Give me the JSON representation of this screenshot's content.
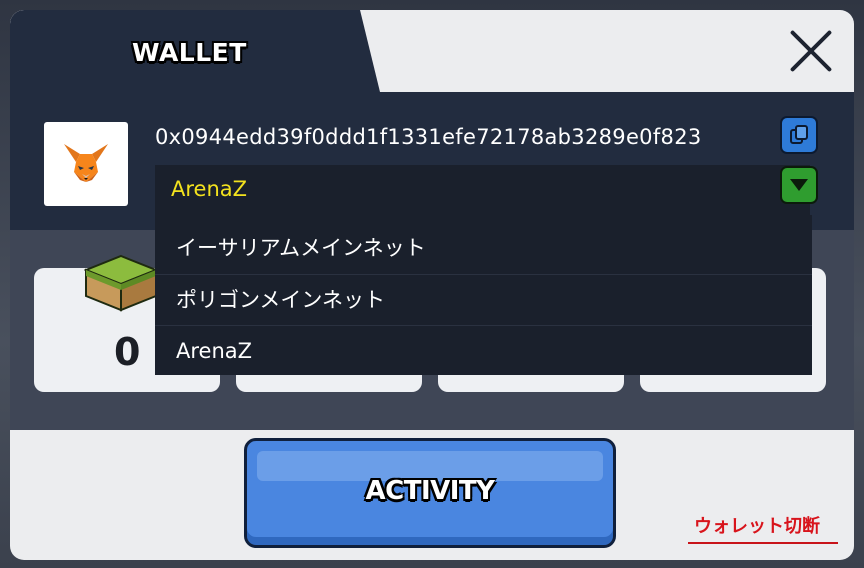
{
  "wallet_panel": {
    "tab_title": "WALLET",
    "address": "0x0944edd39f0ddd1f1331efe72178ab3289e0f823",
    "network_select": {
      "selected": "ArenaZ",
      "options": [
        "イーサリアムメインネット",
        "ポリゴンメインネット",
        "ArenaZ"
      ]
    },
    "stats": [
      {
        "icon": "land-cube-icon",
        "count": "0"
      }
    ],
    "activity_label": "ACTIVITY",
    "disconnect_label": "ウォレット切断"
  },
  "icons": {
    "avatar": "metamask-fox-icon",
    "copy": "copy-icon",
    "dropdown": "triangle-down-icon",
    "close": "close-icon"
  },
  "colors": {
    "panel_dark": "#222c3f",
    "select_text": "#f3e21e",
    "copy_button": "#2e7bd8",
    "dropdown_button": "#2f9d2f",
    "activity_button": "#4a86e0",
    "disconnect": "#d8141c"
  }
}
